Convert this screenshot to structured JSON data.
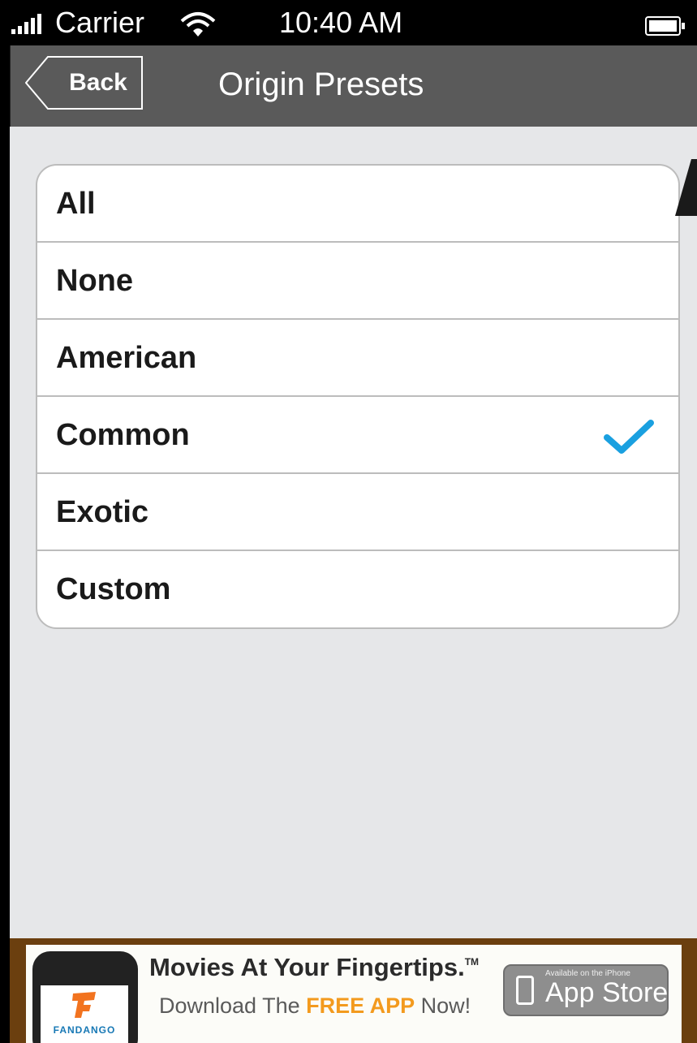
{
  "status_bar": {
    "carrier": "Carrier",
    "time": "10:40 AM"
  },
  "nav_bar": {
    "back_label": "Back",
    "title": "Origin Presets"
  },
  "presets": {
    "items": [
      {
        "label": "All",
        "selected": false
      },
      {
        "label": "None",
        "selected": false
      },
      {
        "label": "American",
        "selected": false
      },
      {
        "label": "Common",
        "selected": true
      },
      {
        "label": "Exotic",
        "selected": false
      },
      {
        "label": "Custom",
        "selected": false
      }
    ]
  },
  "ad": {
    "headline": "Movies At Your Fingertips.",
    "trademark": "TM",
    "subline_prefix": "Download The ",
    "subline_highlight": "FREE APP",
    "subline_suffix": " Now!",
    "brand": "FANDANGO",
    "store_small": "Available on the iPhone",
    "store_big": "App Store",
    "highlight_color": "#f39a1e"
  },
  "colors": {
    "nav_bar": "#5a5a5a",
    "background": "#e6e7e9",
    "checkmark": "#1aa0e0",
    "ad_frame": "#6b3f0f"
  }
}
